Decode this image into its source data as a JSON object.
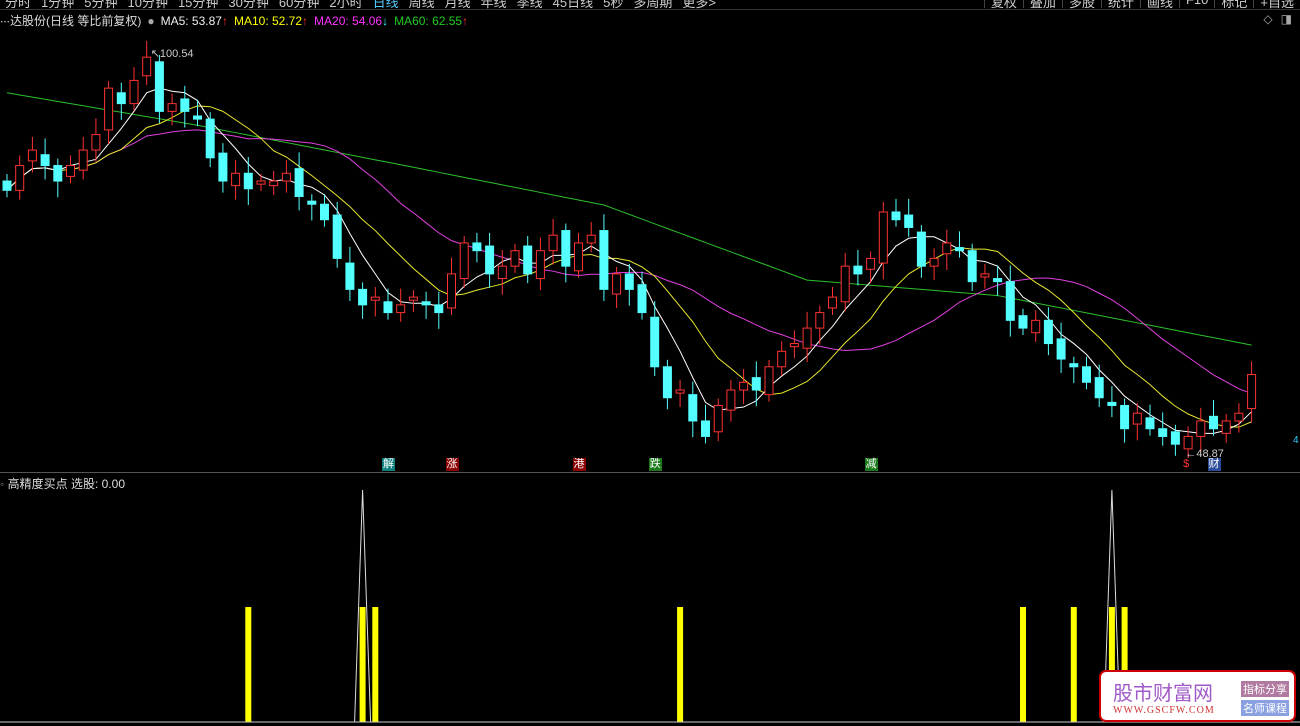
{
  "toolbar": {
    "periods": [
      "分时",
      "1分钟",
      "5分钟",
      "10分钟",
      "15分钟",
      "30分钟",
      "60分钟",
      "2小时",
      "日线",
      "周线",
      "月线",
      "年线",
      "季线",
      "45日线",
      "5秒",
      "多周期",
      "更多>"
    ],
    "active": "日线",
    "right": [
      "复权",
      "叠加",
      "多股",
      "统计",
      "画线",
      "F10",
      "标记",
      "+自选"
    ]
  },
  "header": {
    "title": "∙∙∙达股份(日线 等比前复权)",
    "ma5": "MA5: 53.87",
    "ma5_arrow": "↑",
    "ma10": "MA10: 52.72",
    "ma10_arrow": "↑",
    "ma20": "MA20: 54.06",
    "ma20_arrow": "↓",
    "ma60": "MA60: 62.55",
    "ma60_arrow": "↑"
  },
  "annotations": {
    "high": "100.54",
    "low": "48.87",
    "axis_edge": "4"
  },
  "signals": [
    {
      "label": "解",
      "index": 30,
      "bg": "#138080"
    },
    {
      "label": "涨",
      "index": 35,
      "bg": "#8b0000"
    },
    {
      "label": "港",
      "index": 45,
      "bg": "#8b0000"
    },
    {
      "label": "跌",
      "index": 51,
      "bg": "#1a7a1a"
    },
    {
      "label": "减",
      "index": 68,
      "bg": "#1a7a1a"
    },
    {
      "label": "$",
      "index": 93,
      "bg": "#000"
    },
    {
      "label": "财",
      "index": 95,
      "bg": "#2a4c9a"
    }
  ],
  "lower": {
    "title": "高精度买点",
    "pick": "选股: 0.00",
    "bars": [
      19,
      28,
      29,
      53,
      80,
      84,
      87,
      88
    ],
    "spikes": [
      28,
      87
    ]
  },
  "chart_data": {
    "type": "candlestick",
    "price_range": [
      48.87,
      100.54
    ],
    "closes": [
      82.8,
      86,
      88,
      86,
      84,
      86,
      88,
      90,
      96,
      94,
      97,
      100,
      93,
      94,
      93,
      92,
      87,
      84,
      85,
      83,
      84,
      84,
      85,
      82,
      81,
      79,
      74,
      70,
      68,
      69,
      67,
      68,
      69,
      68,
      67,
      72,
      76,
      75,
      72,
      73,
      75,
      72,
      75,
      77,
      73,
      76,
      77,
      70,
      72,
      70,
      67,
      60,
      56,
      57,
      53,
      51,
      55,
      57,
      58,
      57,
      60,
      62,
      63,
      65,
      67,
      69,
      73,
      72,
      74,
      80,
      79,
      78,
      73,
      74,
      76,
      75,
      71,
      72,
      71,
      66,
      65,
      66,
      63,
      61,
      60,
      58,
      56,
      55,
      52,
      54,
      52,
      51,
      50,
      51,
      53,
      52,
      53,
      54,
      59
    ],
    "ma60_anchors": [
      [
        0,
        95.4
      ],
      [
        15,
        91.2
      ],
      [
        31,
        86.1
      ],
      [
        47,
        80.9
      ],
      [
        63,
        71.2
      ],
      [
        78,
        69.2
      ],
      [
        98,
        62.8
      ]
    ],
    "colors": {
      "up": "#ff3232",
      "down": "#54ffff",
      "ma5": "#ffffff",
      "ma10": "#e8e830",
      "ma20": "#e040e0",
      "ma60": "#2cc02c",
      "bar": "#ffff00"
    }
  },
  "watermark": {
    "name": "股市财富网",
    "url": "WWW.GSCFW.COM",
    "tag1": "指标分享",
    "tag2": "名师课程"
  }
}
